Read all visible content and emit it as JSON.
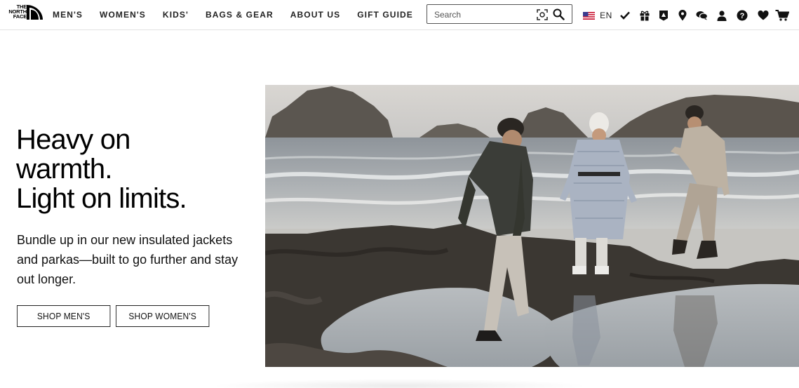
{
  "brand": {
    "logo_text_lines": [
      "THE",
      "NORTH",
      "FACE"
    ]
  },
  "nav": {
    "items": [
      "MEN'S",
      "WOMEN'S",
      "KIDS'",
      "BAGS & GEAR",
      "ABOUT US",
      "GIFT GUIDE"
    ]
  },
  "search": {
    "placeholder": "Search",
    "icons": [
      "camera-scan-icon",
      "search-icon"
    ]
  },
  "utility": {
    "language": "EN",
    "icons": [
      "us-flag-icon",
      "checkmark-icon",
      "gift-icon",
      "xplr-pass-icon",
      "location-pin-icon",
      "chat-icon",
      "account-icon",
      "help-icon",
      "wishlist-heart-icon",
      "cart-icon"
    ]
  },
  "hero": {
    "title_lines": [
      "Heavy on",
      "warmth.",
      "Light on limits."
    ],
    "body": "Bundle up in our new insulated jackets and parkas—built to go further and stay out longer.",
    "buttons": {
      "men": "SHOP MEN'S",
      "women": "SHOP WOMEN'S"
    },
    "image": "hero-photo"
  },
  "colors": {
    "text": "#000000",
    "border": "#222222",
    "header_divider": "#e2e2e2"
  }
}
